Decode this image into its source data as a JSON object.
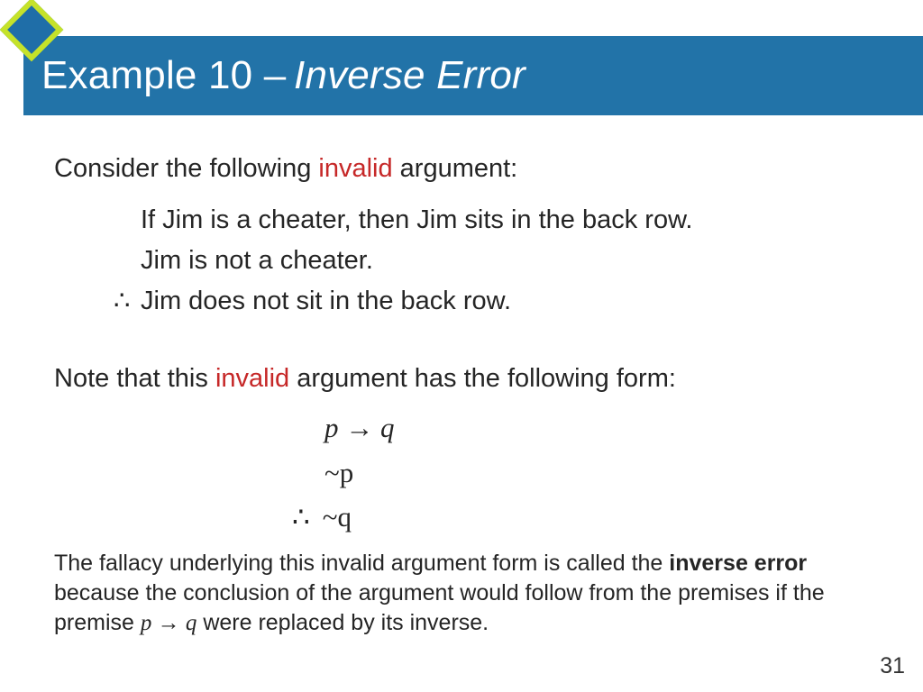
{
  "title": {
    "prefix": "Example 10 – ",
    "emph": "Inverse Error"
  },
  "intro": {
    "pre": "Consider the following ",
    "red": "invalid",
    "post": " argument:"
  },
  "argument": {
    "p1": "If Jim is a cheater, then Jim sits in the back row.",
    "p2": "Jim is not a cheater.",
    "c": "Jim does not sit in the back row."
  },
  "note": {
    "pre": "Note that this ",
    "red": "invalid",
    "post": " argument has the following form:"
  },
  "form": {
    "l1": "p → q",
    "l2": "~p",
    "l3": "~q",
    "therefore": "∴"
  },
  "explanation": {
    "t1": "The fallacy underlying this invalid argument form is called the ",
    "bold": "inverse error",
    "t2": " because the conclusion of the argument would follow from the premises if the premise ",
    "ital": "p → q",
    "t3": " were replaced by its inverse."
  },
  "page": "31"
}
